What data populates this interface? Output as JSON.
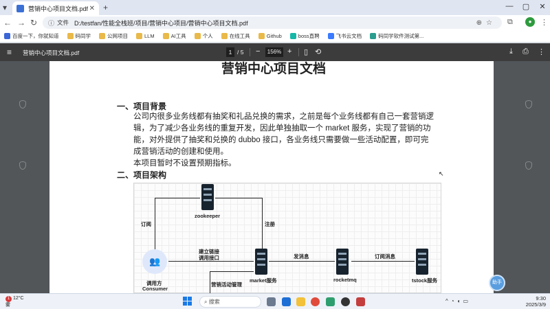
{
  "browser": {
    "tab_title": "营销中心项目文档.pdf",
    "new_tab_icon": "plus-icon",
    "site_label": "文件",
    "url": "D:/testfan/性能全栈班/项目/营销中心项目/营销中心项目文档.pdf"
  },
  "bookmarks": [
    {
      "label": "百度一下，你就知道",
      "color": "#3a66d6"
    },
    {
      "label": "码同学",
      "color": "#e9b949"
    },
    {
      "label": "公网项目",
      "color": "#e9b949"
    },
    {
      "label": "LLM",
      "color": "#e9b949"
    },
    {
      "label": "AI工具",
      "color": "#e9b949"
    },
    {
      "label": "个人",
      "color": "#e9b949"
    },
    {
      "label": "在线工具",
      "color": "#e9b949"
    },
    {
      "label": "Github",
      "color": "#e9b949"
    },
    {
      "label": "boss直聘",
      "color": "#15b7a8"
    },
    {
      "label": "飞书云文档",
      "color": "#3a7bff"
    },
    {
      "label": "码同学软件测试第...",
      "color": "#2a9d8f"
    }
  ],
  "pdf": {
    "file_name": "营销中心项目文档.pdf",
    "current_page": "1",
    "page_total": "/ 5",
    "zoom": "156%",
    "zoom_out": "−",
    "zoom_in": "+"
  },
  "document": {
    "title": "营销中心项目文档",
    "section1": "一、项目背景",
    "para_lines": [
      "公司内很多业务线都有抽奖和礼品兑换的需求，之前是每个业务线都有自己一套营销逻",
      "辑，为了减少各业务线的重复开发，因此单独抽取一个 market 服务，实现了营销的功",
      "能，对外提供了抽奖和兑换的 dubbo 接口，各业务线只需要做一些活动配置，即可完",
      "成营销活动的创建和使用。"
    ],
    "para2": "本项目暂时不设置预期指标。",
    "section2": "二、项目架构"
  },
  "diagram": {
    "zookeeper": "zookeeper",
    "subscribe": "订阅",
    "register": "注册",
    "connect_line1": "建立链接",
    "connect_line2": "调用接口",
    "send_msg": "发消息",
    "sub_msg": "订阅消息",
    "consumer_line1": "调用方",
    "consumer_line2": "Consumer",
    "market": "market服务",
    "rocketmq": "rocketmq",
    "tstock": "tstock服务",
    "activity_mgmt": "营销活动管理"
  },
  "assistant_badge": "助手",
  "taskbar": {
    "weather_temp": "12°C",
    "weather_desc": "雾",
    "notification_count": "1",
    "search_placeholder": "搜索",
    "time": "9:30",
    "date": "2025/3/9"
  }
}
